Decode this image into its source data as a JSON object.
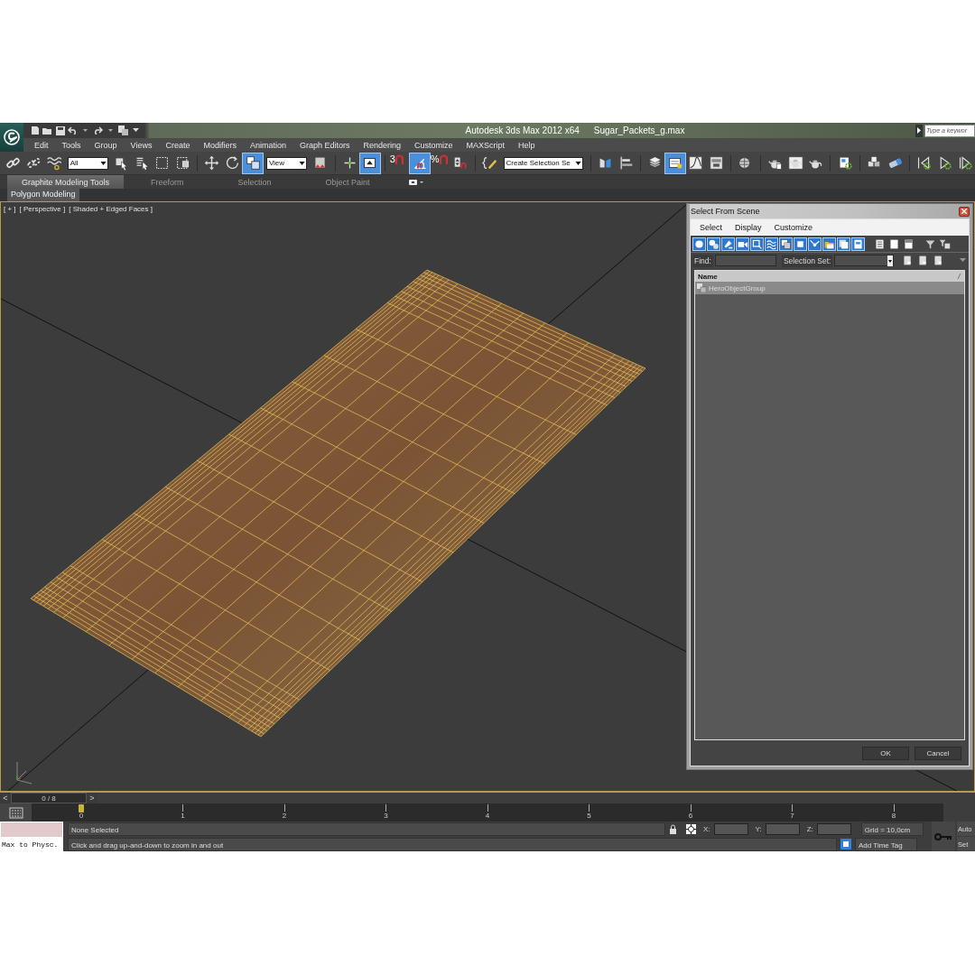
{
  "title_bar": {
    "app_title": "Autodesk 3ds Max  2012 x64",
    "file_name": "Sugar_Packets_g.max",
    "search_placeholder": "Type a keywor"
  },
  "menu": [
    "Edit",
    "Tools",
    "Group",
    "Views",
    "Create",
    "Modifiers",
    "Animation",
    "Graph Editors",
    "Rendering",
    "Customize",
    "MAXScript",
    "Help"
  ],
  "toolbar": [
    {
      "kind": "button",
      "active": false
    },
    {
      "kind": "button",
      "active": false
    },
    {
      "kind": "button",
      "active": false
    },
    {
      "kind": "dropdown",
      "value": "All"
    },
    {
      "kind": "button",
      "active": false
    },
    {
      "kind": "button",
      "active": false
    },
    {
      "kind": "button",
      "active": false
    },
    {
      "kind": "button",
      "active": false
    },
    {
      "kind": "separator"
    },
    {
      "kind": "button",
      "active": false
    },
    {
      "kind": "button",
      "active": false
    },
    {
      "kind": "button",
      "active": true
    },
    {
      "kind": "dropdown",
      "value": "View"
    },
    {
      "kind": "button",
      "active": false
    },
    {
      "kind": "separator"
    },
    {
      "kind": "button",
      "active": false
    },
    {
      "kind": "button",
      "active": true
    },
    {
      "kind": "separator"
    },
    {
      "kind": "snap",
      "label": "3"
    },
    {
      "kind": "button",
      "active": true
    },
    {
      "kind": "snap",
      "label": "%"
    },
    {
      "kind": "button",
      "active": false
    },
    {
      "kind": "separator"
    },
    {
      "kind": "button",
      "active": false
    },
    {
      "kind": "combo",
      "value": "Create Selection Se"
    },
    {
      "kind": "separator"
    },
    {
      "kind": "button",
      "active": false
    },
    {
      "kind": "button",
      "active": false
    },
    {
      "kind": "separator"
    },
    {
      "kind": "button",
      "active": false
    },
    {
      "kind": "button",
      "active": true
    },
    {
      "kind": "button",
      "active": false
    },
    {
      "kind": "button",
      "active": false
    },
    {
      "kind": "separator"
    },
    {
      "kind": "button",
      "active": false
    },
    {
      "kind": "separator"
    },
    {
      "kind": "button",
      "active": false
    },
    {
      "kind": "button",
      "active": false
    },
    {
      "kind": "button",
      "active": false
    },
    {
      "kind": "separator"
    },
    {
      "kind": "button",
      "active": false
    },
    {
      "kind": "separator"
    },
    {
      "kind": "button",
      "active": false
    },
    {
      "kind": "button",
      "active": false
    },
    {
      "kind": "separator"
    },
    {
      "kind": "button",
      "active": false
    },
    {
      "kind": "button",
      "active": false
    },
    {
      "kind": "button",
      "active": false
    }
  ],
  "ribbon": {
    "tabs": [
      {
        "label": "Graphite Modeling Tools",
        "selected": true
      },
      {
        "label": "Freeform",
        "selected": false
      },
      {
        "label": "Selection",
        "selected": false
      },
      {
        "label": "Object Paint",
        "selected": false
      }
    ],
    "panel": "Polygon Modeling"
  },
  "viewport": {
    "labels": [
      "[ + ]",
      "[ Perspective ]",
      "[ Shaded + Edged Faces ]"
    ]
  },
  "dialog": {
    "title": "Select From Scene",
    "menu": [
      "Select",
      "Display",
      "Customize"
    ],
    "toolbar": [
      {
        "active": true
      },
      {
        "active": true
      },
      {
        "active": true
      },
      {
        "active": true
      },
      {
        "active": true
      },
      {
        "active": true
      },
      {
        "active": true
      },
      {
        "active": true
      },
      {
        "active": true
      },
      {
        "active": true
      },
      {
        "active": true
      },
      {
        "active": true
      },
      {
        "active": false
      },
      {
        "active": false
      },
      {
        "active": false
      }
    ],
    "find_label": "Find:",
    "selection_set_label": "Selection Set:",
    "columns": [
      "Name"
    ],
    "rows": [
      {
        "name": "HeroObjectGroup",
        "selected": true
      }
    ],
    "buttons": [
      "OK",
      "Cancel"
    ]
  },
  "time_slider": {
    "prev": "<",
    "position": "0 / 8",
    "next": ">"
  },
  "track_bar": {
    "ticks": [
      "0",
      "1",
      "2",
      "3",
      "4",
      "5",
      "6",
      "7",
      "8"
    ]
  },
  "status": {
    "script_line": "Max to Physc.",
    "selection": "None Selected",
    "prompt": "Click and drag up-and-down to zoom in and out",
    "coords": [
      "X:",
      "Y:",
      "Z:"
    ],
    "grid": "Grid = 10,0cm",
    "time_tag": "Add Time Tag",
    "auto_key": "Auto",
    "set_key": "Set"
  }
}
